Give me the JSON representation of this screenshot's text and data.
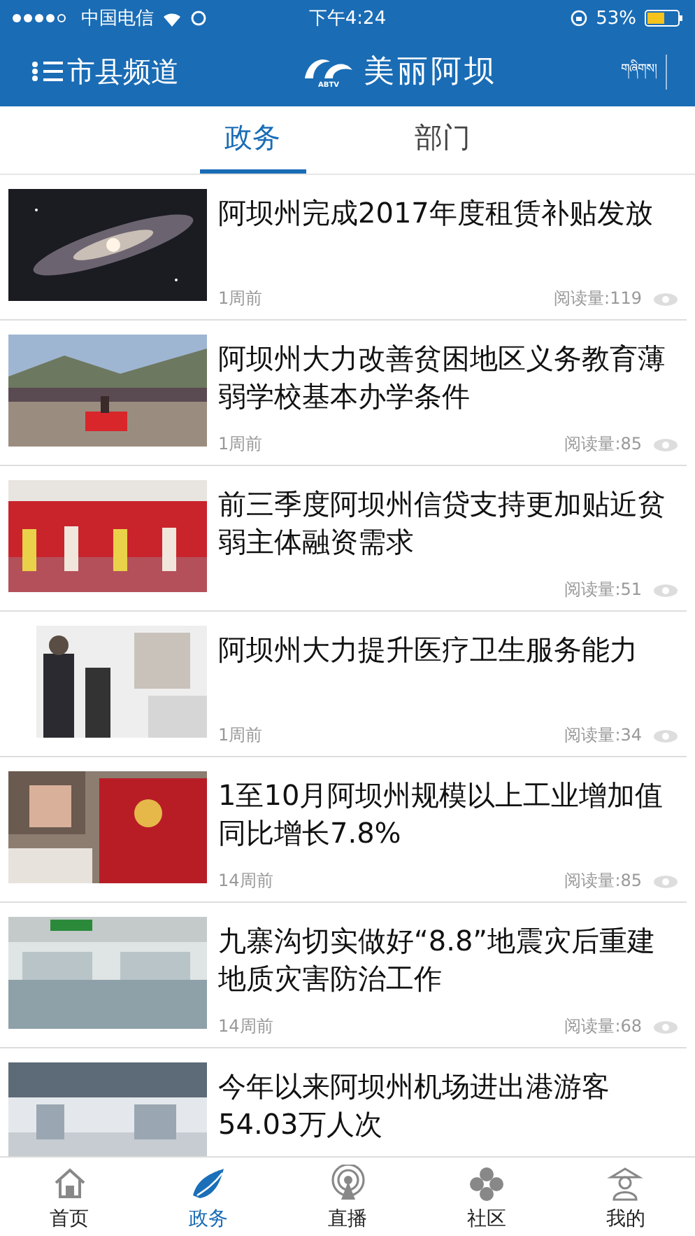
{
  "status_bar": {
    "carrier": "中国电信",
    "time": "下午4:24",
    "battery": "53%"
  },
  "header": {
    "menu_label": "市县频道",
    "logo_badge": "ABTV",
    "logo_text": "美丽阿坝",
    "right_label": "གཞིགས།"
  },
  "tabs": [
    {
      "label": "政务",
      "selected": true
    },
    {
      "label": "部门",
      "selected": false
    }
  ],
  "articles": [
    {
      "title": "阿坝州完成2017年度租赁补贴发放",
      "time": "1周前",
      "reads": "阅读量:119",
      "kind": "picture"
    },
    {
      "title": "阿坝州大力改善贫困地区义务教育薄弱学校基本办学条件",
      "time": "1周前",
      "reads": "阅读量:85",
      "kind": "picture"
    },
    {
      "title": "前三季度阿坝州信贷支持更加贴近贫弱主体融资需求",
      "reads": "阅读量:51",
      "kind": "picture"
    },
    {
      "title": "阿坝州大力提升医疗卫生服务能力",
      "time": "1周前",
      "reads": "阅读量:34",
      "kind": "picture"
    },
    {
      "title": "1至10月阿坝州规模以上工业增加值同比增长7.8%",
      "time": "14周前",
      "reads": "阅读量:85",
      "kind": "picture"
    },
    {
      "title": "九寨沟切实做好“8.8”地震灾后重建地质灾害防治工作",
      "time": "14周前",
      "reads": "阅读量:68",
      "kind": "picture"
    },
    {
      "title": "今年以来阿坝州机场进出港游客54.03万人次",
      "kind": "picture"
    }
  ],
  "nav": [
    {
      "label": "首页",
      "selected": false
    },
    {
      "label": "政务",
      "selected": true
    },
    {
      "label": "直播",
      "selected": false
    },
    {
      "label": "社区",
      "selected": false
    },
    {
      "label": "我的",
      "selected": false
    }
  ]
}
